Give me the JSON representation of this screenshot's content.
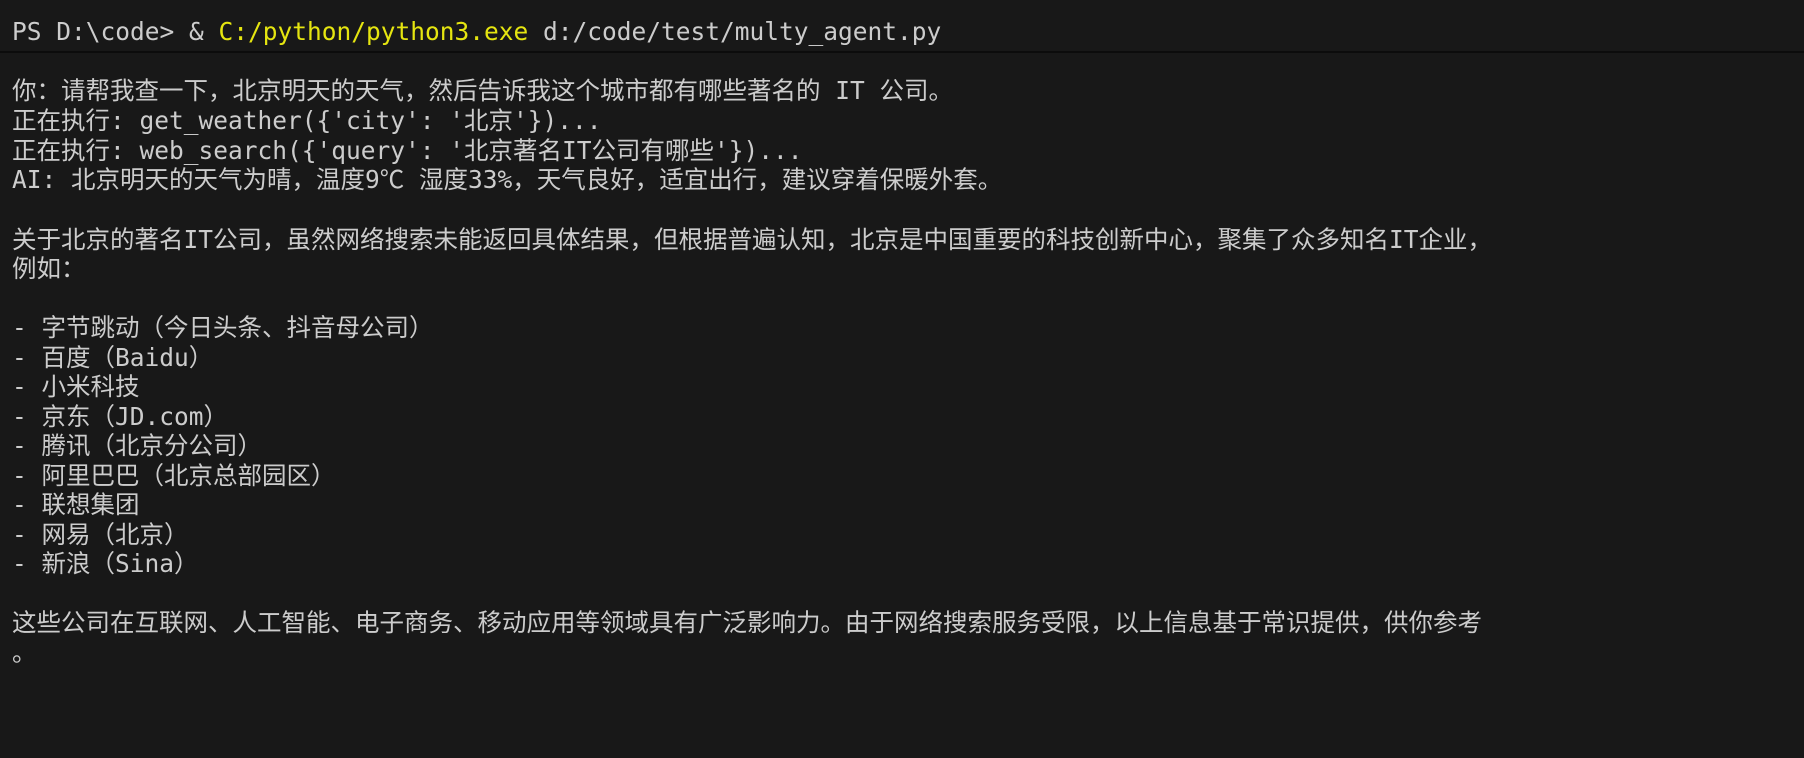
{
  "terminal": {
    "prompt": {
      "ps": "PS D:\\code> & ",
      "exe": "C:/python/python3.exe",
      "script": " d:/code/test/multy_agent.py"
    },
    "lines": [
      "你：请帮我查一下，北京明天的天气，然后告诉我这个城市都有哪些著名的 IT 公司。",
      "正在执行: get_weather({'city': '北京'})...",
      "正在执行: web_search({'query': '北京著名IT公司有哪些'})...",
      "AI: 北京明天的天气为晴，温度9℃ 湿度33%，天气良好，适宜出行，建议穿着保暖外套。",
      "关于北京的著名IT公司，虽然网络搜索未能返回具体结果，但根据普遍认知，北京是中国重要的科技创新中心，聚集了众多知名IT企业，",
      "例如：",
      "- 字节跳动（今日头条、抖音母公司）",
      "- 百度（Baidu）",
      "- 小米科技",
      "- 京东（JD.com）",
      "- 腾讯（北京分公司）",
      "- 阿里巴巴（北京总部园区）",
      "- 联想集团",
      "- 网易（北京）",
      "- 新浪（Sina）",
      "这些公司在互联网、人工智能、电子商务、移动应用等领域具有广泛影响力。由于网络搜索服务受限，以上信息基于常识提供，供你参考",
      "。"
    ]
  },
  "colors": {
    "background": "#181818",
    "text": "#cccccc",
    "accent_exe": "#e5e510"
  }
}
